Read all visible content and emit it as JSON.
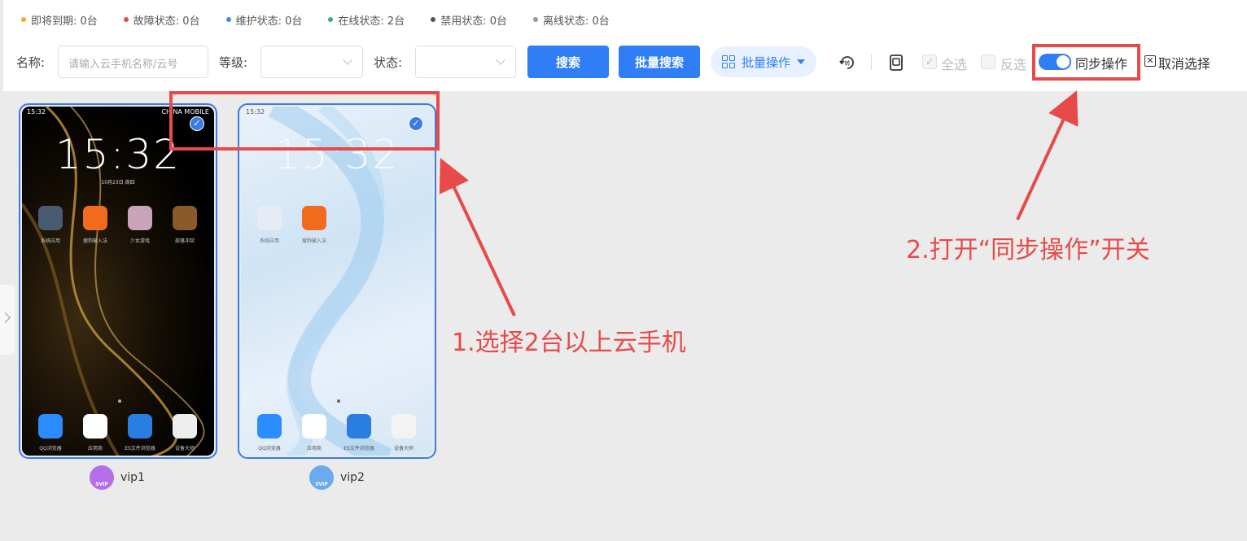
{
  "status_bar": [
    {
      "label": "即将到期: 0台",
      "color": "#f5a623"
    },
    {
      "label": "故障状态: 0台",
      "color": "#e84a4a"
    },
    {
      "label": "维护状态: 0台",
      "color": "#3a8ee6"
    },
    {
      "label": "在线状态: 2台",
      "color": "#2bb673"
    },
    {
      "label": "禁用状态: 0台",
      "color": "#4a5568"
    },
    {
      "label": "离线状态: 0台",
      "color": "#999999"
    }
  ],
  "filters": {
    "name_label": "名称:",
    "name_placeholder": "请输入云手机名称/云号",
    "level_label": "等级:",
    "level_value": "",
    "state_label": "状态:",
    "state_value": "",
    "search_label": "搜索",
    "batch_search_label": "批量搜索",
    "batch_ops_label": "批量操作"
  },
  "toolbar": {
    "select_all_label": "全选",
    "invert_label": "反选",
    "sync_label": "同步操作",
    "sync_enabled": true,
    "cancel_select_label": "取消选择"
  },
  "phones": [
    {
      "name": "vip1",
      "time": "15:32",
      "status_time": "15:32",
      "carrier": "CHINA MOBILE",
      "date": "10月23日 周四",
      "selected": true,
      "apps_top": [
        "系统应用",
        "搜狗输入法",
        "少女游戏",
        "部落冲突"
      ],
      "apps_bottom": [
        "QQ浏览器",
        "应用商",
        "ES文件浏览器",
        "设备大师"
      ]
    },
    {
      "name": "vip2",
      "time": "15:32",
      "status_time": "15:32",
      "carrier": "",
      "date": "",
      "selected": true,
      "apps_top": [
        "系统应用",
        "搜狗输入法"
      ],
      "apps_bottom": [
        "QQ浏览器",
        "应用商",
        "ES文件浏览器",
        "设备大师"
      ]
    }
  ],
  "annotations": {
    "step1": "1.选择2台以上云手机",
    "step2": "2.打开“同步操作”开关"
  },
  "colors": {
    "accent": "#2f7ef5",
    "annotation": "#e84a4a"
  }
}
